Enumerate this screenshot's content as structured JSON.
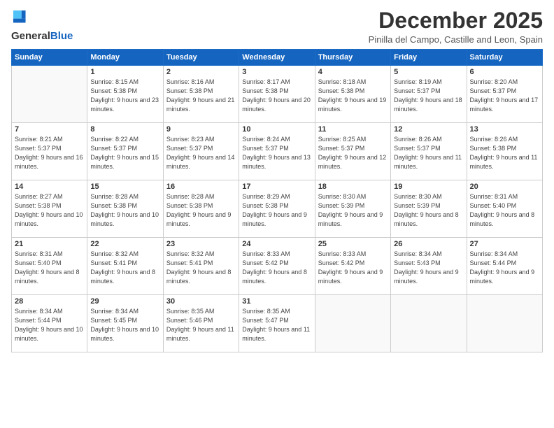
{
  "header": {
    "logo_line1": "General",
    "logo_line2": "Blue",
    "title": "December 2025",
    "location": "Pinilla del Campo, Castille and Leon, Spain"
  },
  "weekdays": [
    "Sunday",
    "Monday",
    "Tuesday",
    "Wednesday",
    "Thursday",
    "Friday",
    "Saturday"
  ],
  "weeks": [
    [
      {
        "day": "",
        "sunrise": "",
        "sunset": "",
        "daylight": ""
      },
      {
        "day": "1",
        "sunrise": "8:15 AM",
        "sunset": "5:38 PM",
        "daylight": "9 hours and 23 minutes."
      },
      {
        "day": "2",
        "sunrise": "8:16 AM",
        "sunset": "5:38 PM",
        "daylight": "9 hours and 21 minutes."
      },
      {
        "day": "3",
        "sunrise": "8:17 AM",
        "sunset": "5:38 PM",
        "daylight": "9 hours and 20 minutes."
      },
      {
        "day": "4",
        "sunrise": "8:18 AM",
        "sunset": "5:38 PM",
        "daylight": "9 hours and 19 minutes."
      },
      {
        "day": "5",
        "sunrise": "8:19 AM",
        "sunset": "5:37 PM",
        "daylight": "9 hours and 18 minutes."
      },
      {
        "day": "6",
        "sunrise": "8:20 AM",
        "sunset": "5:37 PM",
        "daylight": "9 hours and 17 minutes."
      }
    ],
    [
      {
        "day": "7",
        "sunrise": "8:21 AM",
        "sunset": "5:37 PM",
        "daylight": "9 hours and 16 minutes."
      },
      {
        "day": "8",
        "sunrise": "8:22 AM",
        "sunset": "5:37 PM",
        "daylight": "9 hours and 15 minutes."
      },
      {
        "day": "9",
        "sunrise": "8:23 AM",
        "sunset": "5:37 PM",
        "daylight": "9 hours and 14 minutes."
      },
      {
        "day": "10",
        "sunrise": "8:24 AM",
        "sunset": "5:37 PM",
        "daylight": "9 hours and 13 minutes."
      },
      {
        "day": "11",
        "sunrise": "8:25 AM",
        "sunset": "5:37 PM",
        "daylight": "9 hours and 12 minutes."
      },
      {
        "day": "12",
        "sunrise": "8:26 AM",
        "sunset": "5:37 PM",
        "daylight": "9 hours and 11 minutes."
      },
      {
        "day": "13",
        "sunrise": "8:26 AM",
        "sunset": "5:38 PM",
        "daylight": "9 hours and 11 minutes."
      }
    ],
    [
      {
        "day": "14",
        "sunrise": "8:27 AM",
        "sunset": "5:38 PM",
        "daylight": "9 hours and 10 minutes."
      },
      {
        "day": "15",
        "sunrise": "8:28 AM",
        "sunset": "5:38 PM",
        "daylight": "9 hours and 10 minutes."
      },
      {
        "day": "16",
        "sunrise": "8:28 AM",
        "sunset": "5:38 PM",
        "daylight": "9 hours and 9 minutes."
      },
      {
        "day": "17",
        "sunrise": "8:29 AM",
        "sunset": "5:38 PM",
        "daylight": "9 hours and 9 minutes."
      },
      {
        "day": "18",
        "sunrise": "8:30 AM",
        "sunset": "5:39 PM",
        "daylight": "9 hours and 9 minutes."
      },
      {
        "day": "19",
        "sunrise": "8:30 AM",
        "sunset": "5:39 PM",
        "daylight": "9 hours and 8 minutes."
      },
      {
        "day": "20",
        "sunrise": "8:31 AM",
        "sunset": "5:40 PM",
        "daylight": "9 hours and 8 minutes."
      }
    ],
    [
      {
        "day": "21",
        "sunrise": "8:31 AM",
        "sunset": "5:40 PM",
        "daylight": "9 hours and 8 minutes."
      },
      {
        "day": "22",
        "sunrise": "8:32 AM",
        "sunset": "5:41 PM",
        "daylight": "9 hours and 8 minutes."
      },
      {
        "day": "23",
        "sunrise": "8:32 AM",
        "sunset": "5:41 PM",
        "daylight": "9 hours and 8 minutes."
      },
      {
        "day": "24",
        "sunrise": "8:33 AM",
        "sunset": "5:42 PM",
        "daylight": "9 hours and 8 minutes."
      },
      {
        "day": "25",
        "sunrise": "8:33 AM",
        "sunset": "5:42 PM",
        "daylight": "9 hours and 9 minutes."
      },
      {
        "day": "26",
        "sunrise": "8:34 AM",
        "sunset": "5:43 PM",
        "daylight": "9 hours and 9 minutes."
      },
      {
        "day": "27",
        "sunrise": "8:34 AM",
        "sunset": "5:44 PM",
        "daylight": "9 hours and 9 minutes."
      }
    ],
    [
      {
        "day": "28",
        "sunrise": "8:34 AM",
        "sunset": "5:44 PM",
        "daylight": "9 hours and 10 minutes."
      },
      {
        "day": "29",
        "sunrise": "8:34 AM",
        "sunset": "5:45 PM",
        "daylight": "9 hours and 10 minutes."
      },
      {
        "day": "30",
        "sunrise": "8:35 AM",
        "sunset": "5:46 PM",
        "daylight": "9 hours and 11 minutes."
      },
      {
        "day": "31",
        "sunrise": "8:35 AM",
        "sunset": "5:47 PM",
        "daylight": "9 hours and 11 minutes."
      },
      {
        "day": "",
        "sunrise": "",
        "sunset": "",
        "daylight": ""
      },
      {
        "day": "",
        "sunrise": "",
        "sunset": "",
        "daylight": ""
      },
      {
        "day": "",
        "sunrise": "",
        "sunset": "",
        "daylight": ""
      }
    ]
  ]
}
